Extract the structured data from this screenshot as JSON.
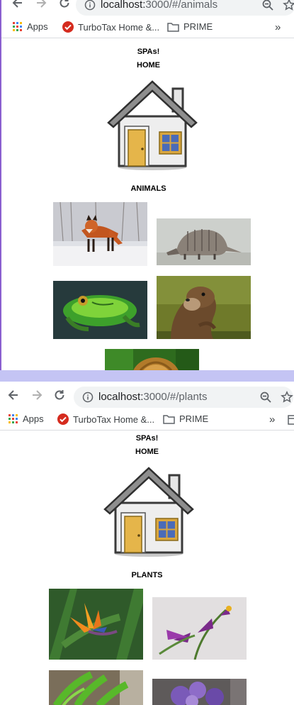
{
  "browser": {
    "url_host": "localhost:",
    "bookmarks": {
      "apps": "Apps",
      "turbotax": "TurboTax Home &...",
      "prime": "PRIME",
      "more": "»"
    }
  },
  "top_window": {
    "url_rest": "3000/#/animals",
    "site_title": "SPAs!",
    "home_link": "HOME",
    "section_heading": "ANIMALS",
    "thumbnails": [
      "fox",
      "armadillo",
      "frog",
      "otter",
      "lion"
    ]
  },
  "bottom_window": {
    "url_rest": "3000/#/plants",
    "site_title": "SPAs!",
    "home_link": "HOME",
    "section_heading": "PLANTS",
    "thumbnails": [
      "bird-of-paradise",
      "purple-orchid",
      "fern",
      "purple-flower"
    ]
  },
  "colors": {
    "accent_border": "#8a5fd0",
    "separator": "#c4c4f4",
    "omnibox": "#f1f3f4"
  }
}
